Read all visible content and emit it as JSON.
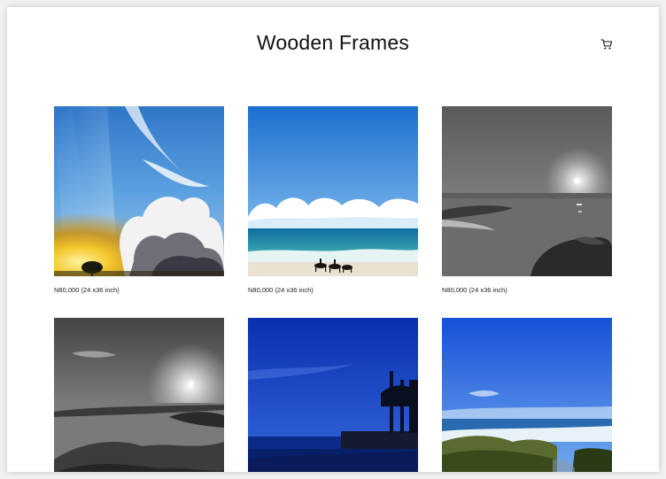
{
  "header": {
    "title": "Wooden Frames",
    "cart_icon": "cart-icon"
  },
  "products": [
    {
      "price_label": "N80,000 (24 x36 inch)",
      "scene": "sunburst-clouds"
    },
    {
      "price_label": "N80,000 (24 x36 inch)",
      "scene": "beach-horses"
    },
    {
      "price_label": "N80,000 (24 x36 inch)",
      "scene": "bw-moon-beach"
    },
    {
      "price_label": "",
      "scene": "bw-rocky-shore"
    },
    {
      "price_label": "",
      "scene": "blue-night-pier"
    },
    {
      "price_label": "",
      "scene": "blue-sky-mossy-rocks"
    }
  ],
  "colors": {
    "background": "#ffffff",
    "text": "#111111"
  }
}
